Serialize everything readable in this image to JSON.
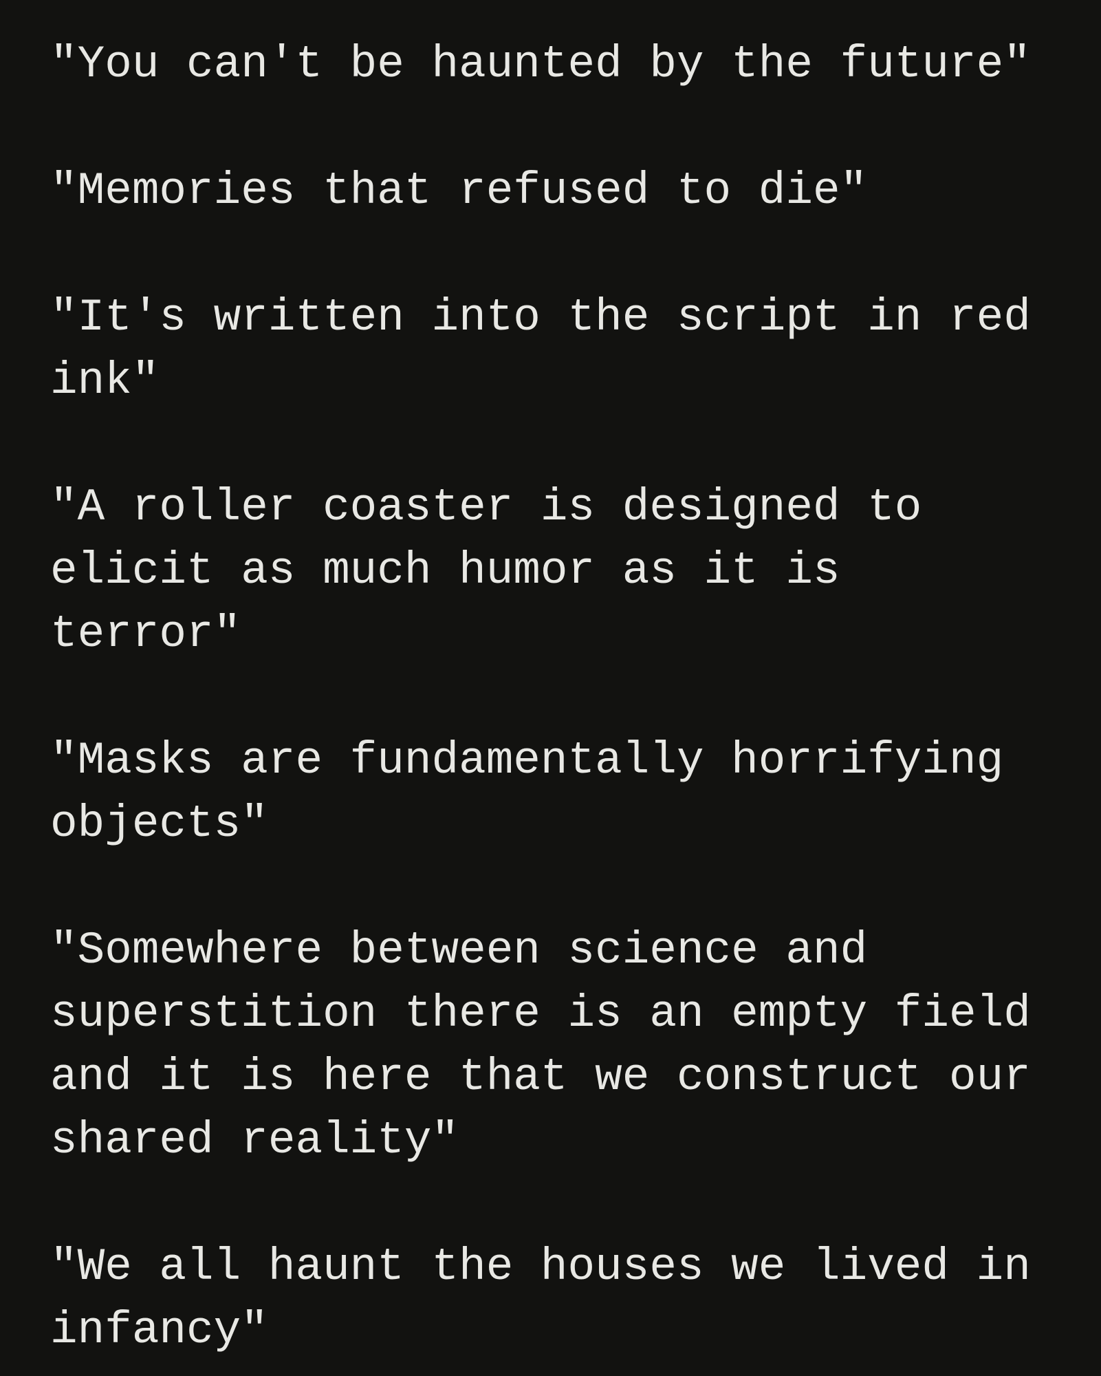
{
  "colors": {
    "background": "#121210",
    "text": "#e8e8e4"
  },
  "quotes": [
    "\"You can't be haunted by the future\"",
    "\"Memories that refused to die\"",
    "\"It's written into the script in red ink\"",
    "\"A roller coaster is designed to elicit as much humor as it is terror\"",
    "\"Masks are fundamentally horrifying objects\"",
    "\"Somewhere between science and superstition there is an empty field and it is here that we construct our shared reality\"",
    "\"We all haunt the houses we lived in infancy\""
  ]
}
